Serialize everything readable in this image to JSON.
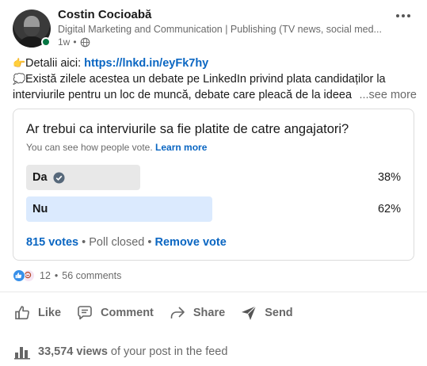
{
  "post": {
    "author": {
      "name": "Costin Cocioabă",
      "headline": "Digital Marketing and Communication | Publishing (TV news, social med...",
      "time": "1w",
      "visibility_icon": "globe-icon"
    },
    "text": {
      "line1_prefix": "Detalii aici: ",
      "line1_link": "https://lnkd.in/eyFk7hy",
      "line2": "Există zilele acestea un debate pe LinkedIn privind plata candidaților la",
      "line3": "interviurile pentru un loc de muncă, debate care pleacă de la ideea",
      "see_more": "...see more"
    },
    "poll": {
      "question": "Ar trebui ca interviurile sa fie platite de catre angajatori?",
      "visibility_note": "You can see how people vote.",
      "learn_more": "Learn more",
      "options": [
        {
          "label": "Da",
          "percent_text": "38%",
          "percent": 38,
          "selected": true
        },
        {
          "label": "Nu",
          "percent_text": "62%",
          "percent": 62,
          "selected": false
        }
      ],
      "votes": "815 votes",
      "separator": "•",
      "status": "Poll closed",
      "remove_vote": "Remove vote"
    },
    "social": {
      "reactions": "12",
      "separator": "•",
      "comments": "56 comments"
    },
    "actions": {
      "like": "Like",
      "comment": "Comment",
      "share": "Share",
      "send": "Send"
    },
    "views": {
      "count": "33,574 views",
      "suffix": "of your post in the feed"
    }
  },
  "colors": {
    "accent": "#0a66c2",
    "presence": "#057642",
    "bar_selected": "#e8e8e8",
    "bar_winner": "#dbeafe"
  }
}
